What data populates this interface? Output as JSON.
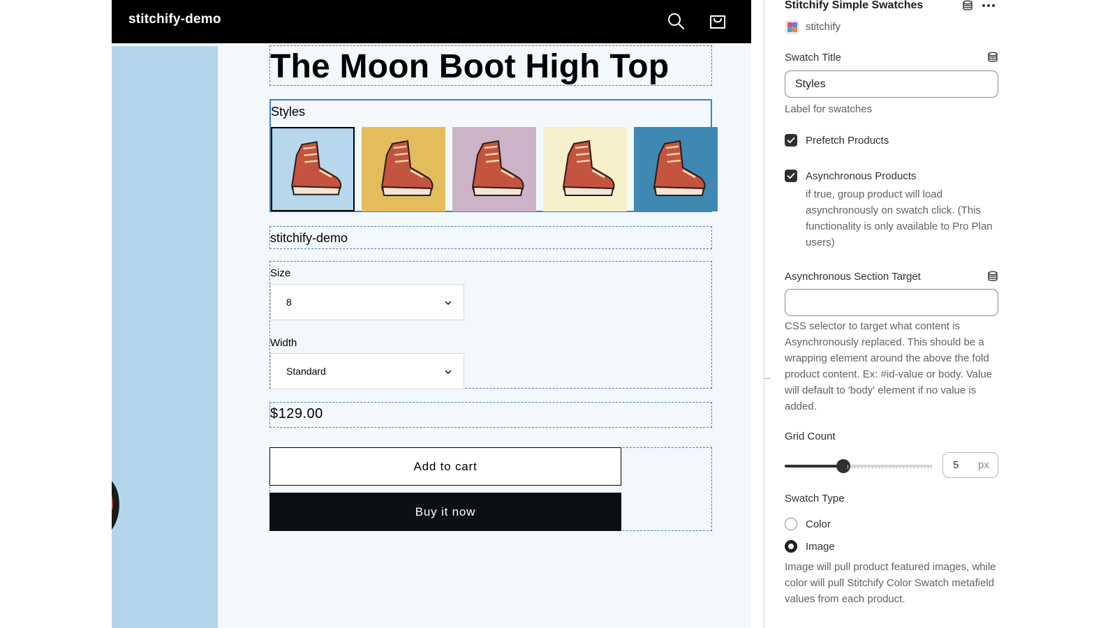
{
  "store": {
    "name": "stitchify-demo"
  },
  "product": {
    "title": "The Moon Boot High Top",
    "swatch_title": "Styles",
    "swatches": [
      {
        "bg": "#b6d7ec",
        "selected": true
      },
      {
        "bg": "#e3bd5c",
        "selected": false
      },
      {
        "bg": "#ccb3c8",
        "selected": false
      },
      {
        "bg": "#f6f0cb",
        "selected": false
      },
      {
        "bg": "#3f88b2",
        "selected": false
      }
    ],
    "vendor": "stitchify-demo",
    "size_label": "Size",
    "size_value": "8",
    "width_label": "Width",
    "width_value": "Standard",
    "price": "$129.00",
    "add_to_cart": "Add to cart",
    "buy_now": "Buy it now"
  },
  "panel": {
    "app_title": "Stitchify Simple Swatches",
    "app_vendor": "stitchify",
    "swatch_title_label": "Swatch Title",
    "swatch_title_value": "Styles",
    "swatch_title_help": "Label for swatches",
    "prefetch_label": "Prefetch Products",
    "prefetch_checked": true,
    "async_label": "Asynchronous Products",
    "async_checked": true,
    "async_help": "if true, group product will load asynchronously on swatch click. (This functionality is only available to Pro Plan users)",
    "async_target_label": "Asynchronous Section Target",
    "async_target_value": "",
    "async_target_help": "CSS selector to target what content is Asynchronously replaced. This should be a wrapping element around the above the fold product content. Ex: #id-value or body. Value will default to 'body' element if no value is added.",
    "grid_count_label": "Grid Count",
    "grid_count_value": "5",
    "grid_count_fraction": 0.4,
    "grid_count_unit": "px",
    "swatch_type_label": "Swatch Type",
    "swatch_type_options": [
      "Color",
      "Image"
    ],
    "swatch_type_selected": "Image",
    "swatch_type_help": "Image will pull product featured images, while color will pull Stitchify Color Swatch metafield values from each product."
  },
  "colors": {
    "header_bg": "#000000",
    "preview_bg": "#f3f8fd",
    "side_image_bg": "#b3d5ea",
    "swatch_border": "#3e7fd0",
    "dashed_outline": "#4f77b8",
    "buy_button_bg": "#0c0f14"
  },
  "icons": [
    "search-icon",
    "cart-icon",
    "chevron-down-icon",
    "database-icon",
    "more-icon",
    "app-logo-icon",
    "checkmark-icon",
    "boot-icon"
  ]
}
